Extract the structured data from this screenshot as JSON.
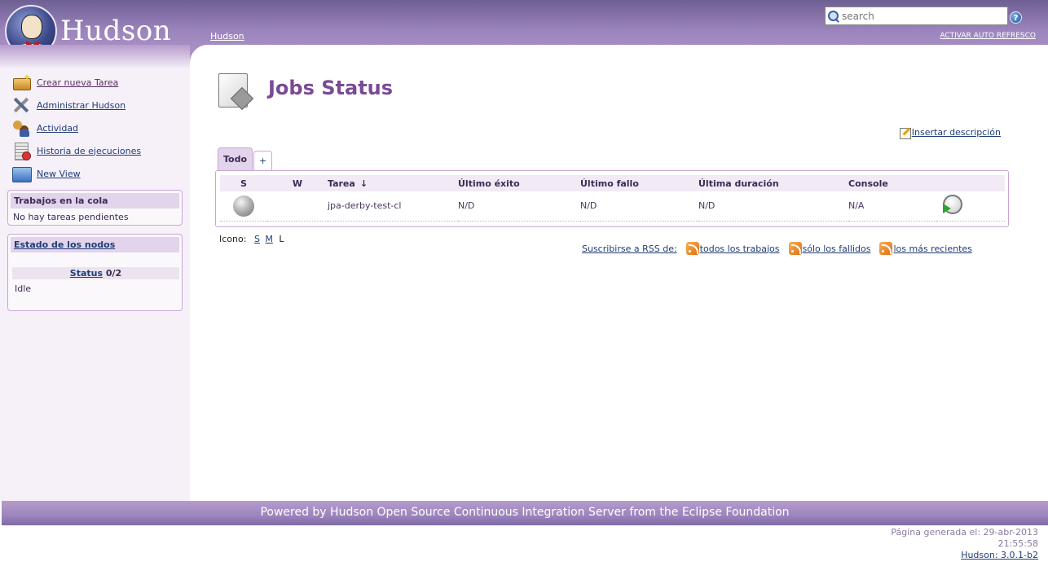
{
  "header": {
    "brand": "Hudson",
    "breadcrumb": "Hudson",
    "search_placeholder": "search",
    "help": "?",
    "autorefresh": "ACTIVAR AUTO REFRESCO"
  },
  "sidebar": {
    "tasks": [
      {
        "label": "Crear nueva Tarea",
        "icon": "new-job-icon"
      },
      {
        "label": "Administrar Hudson",
        "icon": "admin-tools-icon"
      },
      {
        "label": "Actividad",
        "icon": "people-icon"
      },
      {
        "label": "Historia de ejecuciones",
        "icon": "build-history-icon"
      },
      {
        "label": "New View",
        "icon": "folder-icon"
      }
    ],
    "queue": {
      "title": "Trabajos en la cola",
      "empty": "No hay tareas pendientes"
    },
    "nodes": {
      "title": "Estado de los nodos",
      "status_link": "Status",
      "status_count": "0/2",
      "executor_state": "Idle"
    }
  },
  "main": {
    "title": "Jobs Status",
    "add_description": "Insertar descripción",
    "tabs": [
      {
        "label": "Todo",
        "active": true
      },
      {
        "label": "+",
        "active": false
      }
    ],
    "table": {
      "headers": {
        "s": "S",
        "w": "W",
        "job": "Tarea",
        "sort_arrow": "↓",
        "last_success": "Último éxito",
        "last_failure": "Último fallo",
        "last_duration": "Última duración",
        "console": "Console"
      },
      "rows": [
        {
          "status": "grey",
          "job": "jpa-derby-test-cl",
          "last_success": "N/D",
          "last_failure": "N/D",
          "last_duration": "N/D",
          "console": "N/A"
        }
      ]
    },
    "icon_size": {
      "label": "Icono:",
      "small": "S",
      "medium": "M",
      "large": "L"
    },
    "rss": {
      "label": "Suscribirse a RSS de:",
      "all": "todos los trabajos",
      "failed": "sólo los fallidos",
      "latest": "los más recientes"
    }
  },
  "footer": {
    "powered_by": "Powered by Hudson Open Source Continuous Integration Server from the Eclipse Foundation",
    "generated_label": "Página generada el: 29-abr-2013",
    "generated_time": "21:55:58",
    "version": "Hudson: 3.0.1-b2"
  },
  "colors": {
    "header_purple": "#9c85bd",
    "title_purple": "#7a4a95",
    "link_blue": "#1f3d78"
  }
}
